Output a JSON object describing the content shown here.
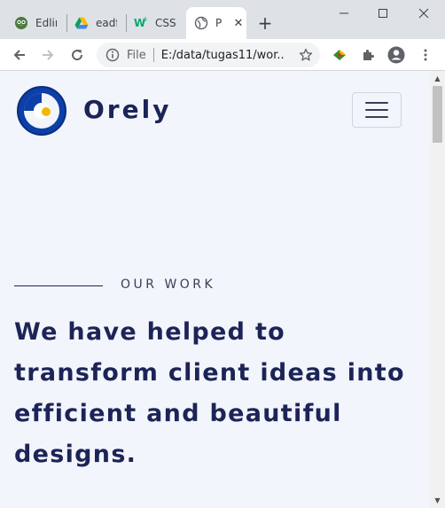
{
  "browser": {
    "tabs": [
      {
        "title": "Edlink",
        "icon": "owl-icon"
      },
      {
        "title": "eadfe",
        "icon": "google-drive-icon"
      },
      {
        "title": "CSS",
        "icon": "w3schools-icon"
      },
      {
        "title": "P",
        "icon": "globe-icon",
        "active": true
      }
    ],
    "new_tab": "+",
    "address": {
      "scheme_label": "File",
      "url": "E:/data/tugas11/wor..."
    }
  },
  "page": {
    "brand": "Orely",
    "section_label": "OUR WORK",
    "headline": "We have helped to transform client ideas into efficient and beautiful designs.",
    "colors": {
      "brand_navy": "#1c2457",
      "logo_blue": "#0d3fa8",
      "logo_accent": "#f2b705",
      "page_bg": "#f2f5fc"
    }
  }
}
